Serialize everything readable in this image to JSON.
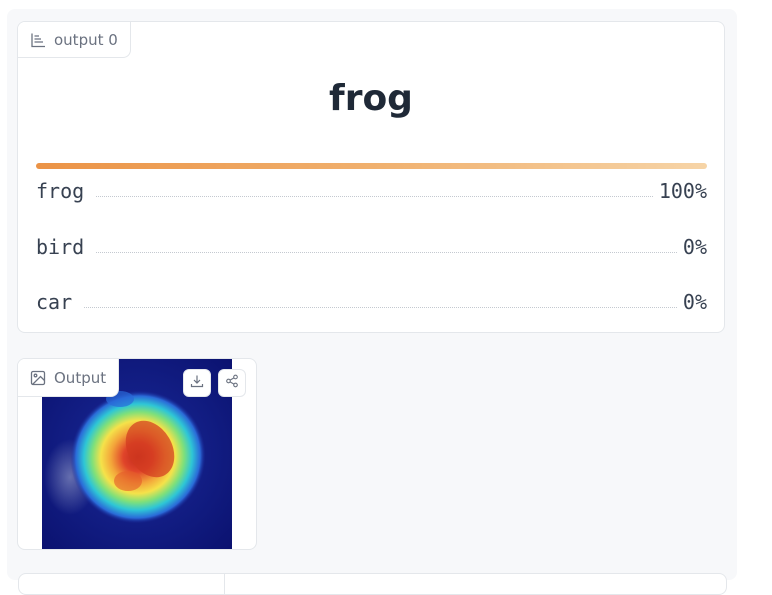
{
  "label_output": {
    "tab_label": "output 0",
    "top_label": "frog",
    "confidences": [
      {
        "label": "frog",
        "value": "100%",
        "fraction": 1.0
      },
      {
        "label": "bird",
        "value": "0%",
        "fraction": 0.0
      },
      {
        "label": "car",
        "value": "0%",
        "fraction": 0.0
      }
    ]
  },
  "image_output": {
    "tab_label": "Output",
    "download_icon": "download-icon",
    "share_icon": "share-icon"
  },
  "colors": {
    "bar_start": "#eb9346",
    "bar_end": "#f6d4a7",
    "panel_bg": "#f7f8fa"
  }
}
